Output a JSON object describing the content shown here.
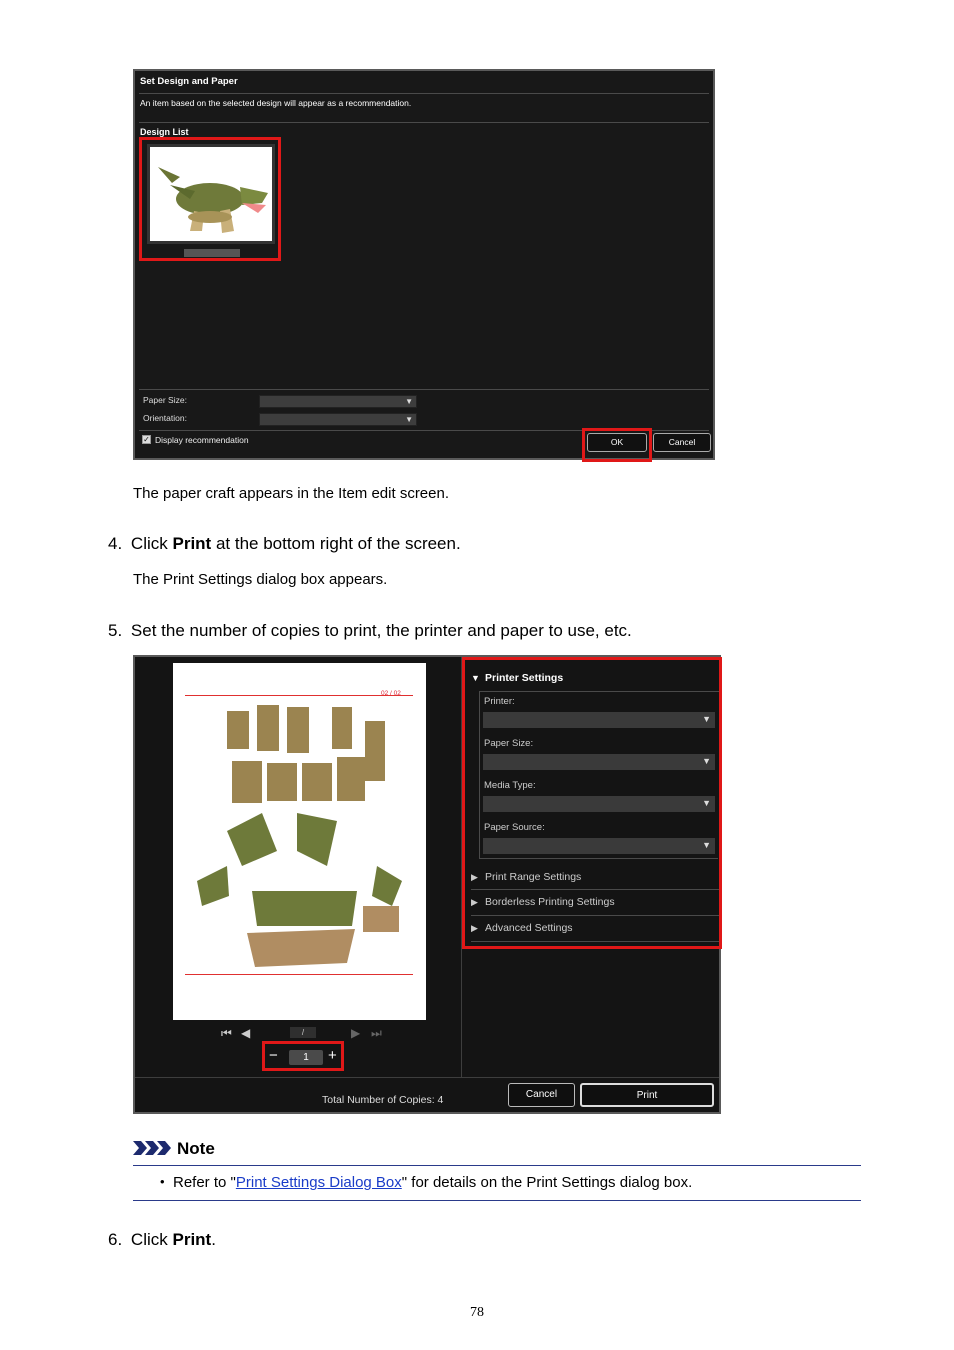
{
  "dialog1": {
    "title": "Set Design and Paper",
    "description": "An item based on the selected design will appear as a recommendation.",
    "design_list_label": "Design List",
    "paper_size_label": "Paper Size:",
    "orientation_label": "Orientation:",
    "display_recommendation_label": "Display recommendation",
    "display_recommendation_checked": true,
    "ok_label": "OK",
    "cancel_label": "Cancel"
  },
  "caption1": "The paper craft appears in the Item edit screen.",
  "step4": {
    "number": "4.",
    "pre": "Click ",
    "bold": "Print",
    "post": " at the bottom right of the screen."
  },
  "caption2": "The Print Settings dialog box appears.",
  "step5": {
    "number": "5.",
    "text": "Set the number of copies to print, the printer and paper to use, etc."
  },
  "dialog2": {
    "preview_page_label": "02 / 02",
    "page_indicator": "/",
    "copies_value": "1",
    "copies_minus": "−",
    "copies_plus": "+",
    "printer_settings_label": "Printer Settings",
    "printer_label": "Printer:",
    "paper_size_label": "Paper Size:",
    "media_type_label": "Media Type:",
    "paper_source_label": "Paper Source:",
    "print_range_label": "Print Range Settings",
    "borderless_label": "Borderless Printing Settings",
    "advanced_label": "Advanced Settings",
    "total_copies_label": "Total Number of Copies:  4",
    "cancel_label": "Cancel",
    "print_label": "Print"
  },
  "note": {
    "heading": "Note",
    "bullet": "•",
    "pre": "Refer to \"",
    "link": "Print Settings Dialog Box",
    "post": "\" for details on the Print Settings dialog box."
  },
  "step6": {
    "number": "6.",
    "pre": "Click ",
    "bold": "Print",
    "post": "."
  },
  "page_number": "78",
  "colors": {
    "highlight": "#e01818",
    "link": "#1a3cc8",
    "note_rule": "#2a3a8a"
  }
}
